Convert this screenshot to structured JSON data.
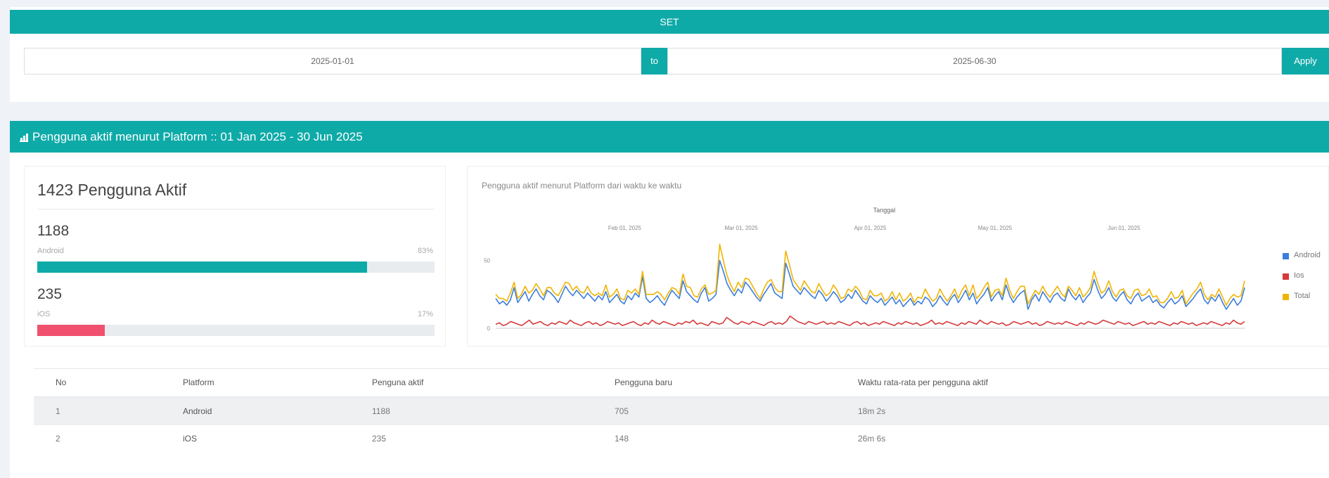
{
  "set_panel": {
    "title": "SET",
    "start_date": "2025-01-01",
    "to_label": "to",
    "end_date": "2025-06-30",
    "apply_label": "Apply"
  },
  "section": {
    "icon": "bar-chart-icon",
    "title": "Pengguna aktif menurut Platform :: 01 Jan 2025 - 30 Jun 2025"
  },
  "summary": {
    "total_label": "1423 Pengguna Aktif",
    "platforms": [
      {
        "count": "1188",
        "name": "Android",
        "percent_label": "83%",
        "fraction": 0.83,
        "color": "#0eaaa8"
      },
      {
        "count": "235",
        "name": "iOS",
        "percent_label": "17%",
        "fraction": 0.17,
        "color": "#f0506e"
      }
    ]
  },
  "chart_panel": {
    "title": "Pengguna aktif menurut Platform dari waktu ke waktu"
  },
  "chart_data": {
    "type": "line",
    "xlabel": "Tanggal",
    "x_ticks": [
      "Feb 01, 2025",
      "Mar 01, 2025",
      "Apr 01, 2025",
      "May 01, 2025",
      "Jun 01, 2025"
    ],
    "x_range": [
      "2025-01-01",
      "2025-06-30"
    ],
    "y_ticks": [
      "0",
      "50"
    ],
    "ylim": [
      0,
      70
    ],
    "legend_position": "right",
    "series": [
      {
        "name": "Android",
        "color": "#3b7ddd",
        "values": [
          22,
          18,
          20,
          17,
          21,
          30,
          19,
          23,
          27,
          20,
          25,
          29,
          24,
          21,
          28,
          26,
          23,
          19,
          25,
          31,
          27,
          24,
          28,
          25,
          22,
          26,
          23,
          20,
          24,
          21,
          27,
          19,
          22,
          25,
          20,
          18,
          24,
          21,
          26,
          23,
          38,
          22,
          19,
          21,
          24,
          20,
          17,
          23,
          28,
          25,
          22,
          35,
          27,
          24,
          21,
          19,
          26,
          30,
          20,
          22,
          25,
          50,
          42,
          33,
          28,
          24,
          29,
          26,
          34,
          31,
          27,
          23,
          20,
          25,
          29,
          33,
          26,
          24,
          22,
          48,
          40,
          31,
          28,
          25,
          30,
          27,
          24,
          22,
          28,
          25,
          20,
          23,
          27,
          24,
          19,
          21,
          25,
          22,
          28,
          24,
          20,
          18,
          24,
          21,
          19,
          22,
          17,
          20,
          23,
          18,
          21,
          16,
          19,
          22,
          17,
          20,
          18,
          23,
          21,
          16,
          19,
          24,
          20,
          17,
          22,
          25,
          19,
          23,
          28,
          21,
          26,
          18,
          22,
          25,
          30,
          20,
          24,
          27,
          21,
          32,
          24,
          19,
          23,
          26,
          28,
          14,
          21,
          25,
          20,
          27,
          23,
          19,
          24,
          26,
          22,
          20,
          29,
          24,
          21,
          25,
          19,
          23,
          26,
          36,
          28,
          22,
          25,
          30,
          23,
          20,
          24,
          27,
          21,
          18,
          23,
          26,
          20,
          22,
          24,
          19,
          21,
          17,
          15,
          19,
          22,
          18,
          20,
          24,
          16,
          19,
          22,
          26,
          29,
          21,
          18,
          23,
          20,
          25,
          19,
          14,
          18,
          22,
          17,
          20,
          30
        ]
      },
      {
        "name": "Ios",
        "color": "#d63a3a",
        "values": [
          3,
          4,
          2,
          3,
          5,
          4,
          3,
          2,
          4,
          6,
          3,
          4,
          5,
          3,
          2,
          4,
          3,
          5,
          4,
          3,
          6,
          4,
          3,
          2,
          4,
          5,
          3,
          4,
          2,
          3,
          5,
          4,
          3,
          4,
          2,
          3,
          4,
          5,
          3,
          2,
          4,
          3,
          6,
          4,
          3,
          5,
          4,
          3,
          2,
          4,
          3,
          5,
          4,
          6,
          3,
          4,
          3,
          2,
          5,
          4,
          3,
          4,
          8,
          6,
          4,
          3,
          5,
          4,
          3,
          5,
          4,
          3,
          2,
          4,
          5,
          3,
          4,
          3,
          5,
          9,
          7,
          5,
          4,
          3,
          5,
          4,
          3,
          4,
          5,
          3,
          4,
          3,
          5,
          4,
          3,
          2,
          4,
          5,
          3,
          4,
          2,
          3,
          4,
          3,
          5,
          4,
          3,
          2,
          4,
          3,
          5,
          4,
          3,
          4,
          2,
          3,
          4,
          6,
          3,
          4,
          3,
          5,
          4,
          3,
          2,
          4,
          3,
          5,
          4,
          3,
          6,
          4,
          3,
          5,
          4,
          3,
          4,
          2,
          3,
          5,
          4,
          3,
          4,
          5,
          3,
          4,
          2,
          3,
          5,
          4,
          3,
          4,
          3,
          5,
          4,
          3,
          2,
          4,
          3,
          5,
          4,
          3,
          4,
          6,
          5,
          4,
          3,
          5,
          4,
          3,
          4,
          2,
          3,
          4,
          5,
          3,
          4,
          3,
          5,
          4,
          3,
          2,
          4,
          3,
          5,
          4,
          3,
          4,
          2,
          3,
          4,
          3,
          5,
          4,
          3,
          2,
          4,
          3,
          6,
          4,
          3,
          5
        ]
      },
      {
        "name": "Total",
        "color": "#f0b400",
        "values": [
          25,
          22,
          22,
          20,
          26,
          34,
          22,
          25,
          31,
          26,
          28,
          33,
          29,
          24,
          30,
          30,
          26,
          24,
          29,
          34,
          33,
          28,
          31,
          27,
          26,
          31,
          26,
          24,
          26,
          24,
          32,
          23,
          25,
          29,
          22,
          21,
          28,
          26,
          29,
          25,
          42,
          25,
          25,
          25,
          27,
          25,
          21,
          26,
          30,
          29,
          25,
          40,
          31,
          30,
          24,
          23,
          29,
          32,
          25,
          26,
          28,
          62,
          50,
          39,
          32,
          27,
          34,
          30,
          37,
          36,
          31,
          26,
          22,
          29,
          34,
          36,
          30,
          27,
          27,
          57,
          47,
          36,
          32,
          28,
          35,
          31,
          27,
          26,
          33,
          28,
          24,
          26,
          32,
          28,
          22,
          23,
          29,
          27,
          31,
          28,
          22,
          21,
          28,
          24,
          24,
          26,
          20,
          22,
          27,
          21,
          26,
          20,
          22,
          26,
          19,
          23,
          22,
          29,
          24,
          20,
          22,
          29,
          24,
          20,
          24,
          29,
          22,
          28,
          32,
          24,
          32,
          22,
          25,
          30,
          34,
          23,
          28,
          29,
          24,
          37,
          28,
          22,
          27,
          31,
          31,
          18,
          23,
          28,
          25,
          31,
          26,
          23,
          27,
          31,
          26,
          23,
          31,
          28,
          24,
          30,
          23,
          26,
          30,
          42,
          33,
          26,
          28,
          35,
          27,
          23,
          28,
          29,
          24,
          22,
          28,
          29,
          24,
          25,
          29,
          23,
          24,
          19,
          19,
          22,
          27,
          22,
          23,
          28,
          18,
          22,
          26,
          29,
          34,
          25,
          21,
          25,
          23,
          29,
          23,
          17,
          22,
          25,
          23,
          24,
          35
        ]
      }
    ]
  },
  "table": {
    "columns": [
      "No",
      "Platform",
      "Penguna aktif",
      "Pengguna baru",
      "Waktu rata-rata per pengguna aktif"
    ],
    "rows": [
      [
        "1",
        "Android",
        "1188",
        "705",
        "18m 2s"
      ],
      [
        "2",
        "iOS",
        "235",
        "148",
        "26m 6s"
      ]
    ]
  }
}
